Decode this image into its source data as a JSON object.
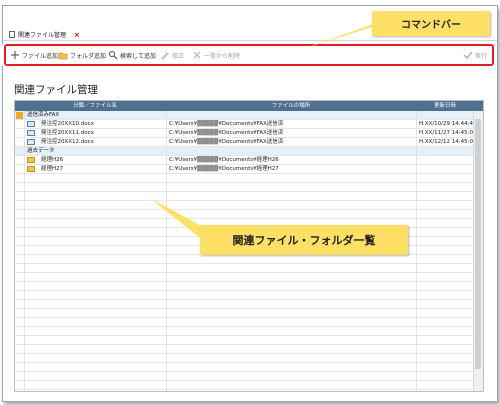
{
  "window": {
    "tab_title": "関連ファイル管理",
    "tab_close": "×"
  },
  "toolbar": {
    "items": [
      {
        "label": "ファイル追加",
        "icon": "plus-icon",
        "enabled": true
      },
      {
        "label": "フォルダ追加",
        "icon": "folder-add-icon",
        "enabled": true
      },
      {
        "label": "検索して追加",
        "icon": "search-icon",
        "enabled": true
      },
      {
        "label": "修正",
        "icon": "pencil-icon",
        "enabled": false
      },
      {
        "label": "一覧から削除",
        "icon": "delete-icon",
        "enabled": false
      }
    ],
    "run_label": "実行",
    "run_icon": "check-icon"
  },
  "page_title": "関連ファイル管理",
  "grid": {
    "columns": [
      "分類／ファイル名",
      "ファイルの場所",
      "更新日時"
    ],
    "rows": [
      {
        "kind": "group",
        "name": "送信済みFAX",
        "location": "",
        "date": "",
        "marker": "orange"
      },
      {
        "kind": "file",
        "name": "発注控20XX10.docx",
        "location": "C:¥Users¥▒▒▒▒▒¥Documents¥FAX送信済",
        "date": "H.XX/10/29 14:44:44",
        "icon": "file-icon"
      },
      {
        "kind": "file",
        "name": "発注控20XX11.docx",
        "location": "C:¥Users¥▒▒▒▒▒¥Documents¥FAX送信済",
        "date": "H.XX/11/27 14:45:08",
        "icon": "file-icon"
      },
      {
        "kind": "file",
        "name": "発注控20XX12.docx",
        "location": "C:¥Users¥▒▒▒▒▒¥Documents¥FAX送信済",
        "date": "H.XX/12/12 14:45:02",
        "icon": "file-icon"
      },
      {
        "kind": "group",
        "name": "過去データ",
        "location": "",
        "date": "",
        "marker": "none"
      },
      {
        "kind": "folder",
        "name": "経理H26",
        "location": "C:¥Users¥▒▒▒▒▒¥Documents¥経理H26",
        "date": "",
        "icon": "folder-icon"
      },
      {
        "kind": "folder",
        "name": "経理H27",
        "location": "C:¥Users¥▒▒▒▒▒¥Documents¥経理H27",
        "date": "",
        "icon": "folder-icon"
      }
    ]
  },
  "callouts": {
    "command_bar": "コマンドバー",
    "list": "関連ファイル・フォルダ一覧"
  },
  "colors": {
    "header": "#4f6f91",
    "callout": "#ffe066",
    "outline": "#e02020",
    "group_row": "#e6eef7"
  }
}
